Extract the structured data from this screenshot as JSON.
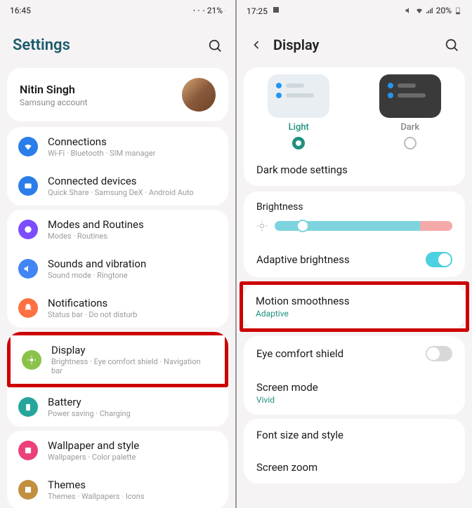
{
  "left": {
    "status": {
      "time": "16:45",
      "battery": "21%"
    },
    "header": {
      "title": "Settings"
    },
    "profile": {
      "name": "Nitin Singh",
      "sub": "Samsung account"
    },
    "g1": [
      {
        "title": "Connections",
        "sub": "Wi-Fi · Bluetooth · SIM manager"
      },
      {
        "title": "Connected devices",
        "sub": "Quick Share · Samsung DeX · Android Auto"
      }
    ],
    "g2": [
      {
        "title": "Modes and Routines",
        "sub": "Modes · Routines"
      },
      {
        "title": "Sounds and vibration",
        "sub": "Sound mode · Ringtone"
      },
      {
        "title": "Notifications",
        "sub": "Status bar · Do not disturb"
      }
    ],
    "g3": [
      {
        "title": "Display",
        "sub": "Brightness · Eye comfort shield · Navigation bar"
      },
      {
        "title": "Battery",
        "sub": "Power saving · Charging"
      }
    ],
    "g4": [
      {
        "title": "Wallpaper and style",
        "sub": "Wallpapers · Color palette"
      },
      {
        "title": "Themes",
        "sub": "Themes · Wallpapers · Icons"
      }
    ]
  },
  "right": {
    "status": {
      "time": "17:25",
      "battery": "20%"
    },
    "header": {
      "title": "Display"
    },
    "theme": {
      "light": "Light",
      "dark": "Dark"
    },
    "dark_mode": "Dark mode settings",
    "brightness": "Brightness",
    "adaptive": "Adaptive brightness",
    "motion": {
      "title": "Motion smoothness",
      "sub": "Adaptive"
    },
    "eye": "Eye comfort shield",
    "screen_mode": {
      "title": "Screen mode",
      "sub": "Vivid"
    },
    "font": "Font size and style",
    "zoom": "Screen zoom"
  }
}
